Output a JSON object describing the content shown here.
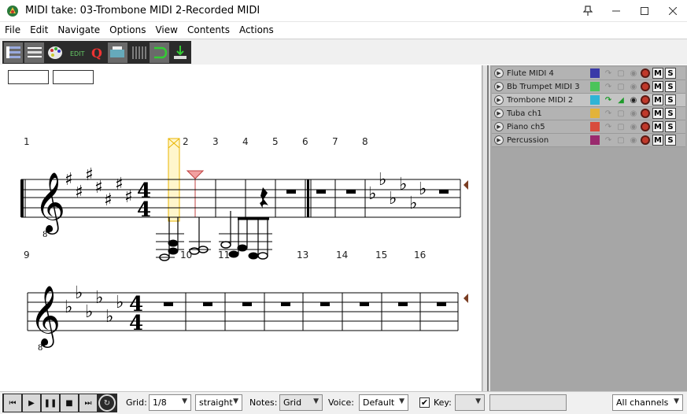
{
  "window": {
    "title": "MIDI take: 03-Trombone MIDI 2-Recorded MIDI"
  },
  "menu": [
    "File",
    "Edit",
    "Navigate",
    "Options",
    "View",
    "Contents",
    "Actions"
  ],
  "toolbar": {
    "buttons": [
      "track-list-icon",
      "ccl-lanes-icon",
      "palette-icon",
      "edit-icon",
      "quantize-icon",
      "chord-icon",
      "grid-lines-icon",
      "loop-icon",
      "insert-icon"
    ]
  },
  "score": {
    "measure_numbers_row1": [
      "1",
      "2",
      "3",
      "4",
      "5",
      "6",
      "7",
      "8"
    ],
    "measure_numbers_row2": [
      "9",
      "10",
      "11",
      "13",
      "14",
      "15",
      "16"
    ],
    "time_signature": {
      "top": "4",
      "bottom": "4"
    },
    "clef_octave": "8"
  },
  "tracks": [
    {
      "name": "Flute MIDI 4",
      "color": "#3a3aa8",
      "selected": false
    },
    {
      "name": "Bb Trumpet MIDI 3",
      "color": "#4bc45a",
      "selected": false
    },
    {
      "name": "Trombone MIDI 2",
      "color": "#2fb4d6",
      "selected": true
    },
    {
      "name": "Tuba ch1",
      "color": "#e3b33a",
      "selected": false
    },
    {
      "name": "Piano ch5",
      "color": "#d84c3c",
      "selected": false
    },
    {
      "name": "Percussion",
      "color": "#9a2a6e",
      "selected": false
    }
  ],
  "track_buttons": {
    "mute": "M",
    "solo": "S"
  },
  "bottom": {
    "grid_label": "Grid:",
    "grid_value": "1/8",
    "swing_value": "straight",
    "notes_label": "Notes:",
    "notes_value": "Grid",
    "voice_label": "Voice:",
    "voice_value": "Default",
    "key_checked": true,
    "key_label": "Key:",
    "key_value": "",
    "channels_value": "All channels"
  }
}
